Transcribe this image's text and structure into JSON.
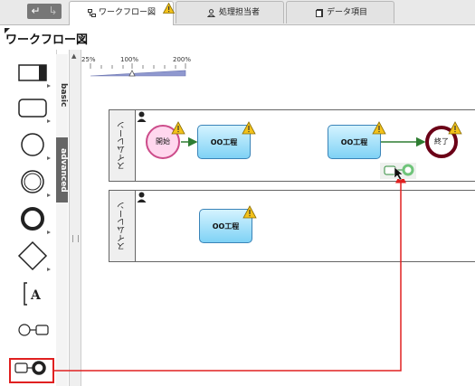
{
  "toolbar": {
    "undo_icon": "undo-arrow-icon",
    "redo_icon": "redo-arrow-icon"
  },
  "tabs": [
    {
      "label": "ワークフロー図",
      "icon": "flow-icon",
      "active": true,
      "warning": true
    },
    {
      "label": "処理担当者",
      "icon": "person-icon",
      "active": false
    },
    {
      "label": "データ項目",
      "icon": "document-icon",
      "active": false
    }
  ],
  "panel": {
    "title": "ワークフロー図"
  },
  "palette_tabs": [
    {
      "label": "basic"
    },
    {
      "label": "advanced"
    }
  ],
  "palette_items": [
    {
      "icon": "task-rectangle-icon"
    },
    {
      "icon": "rounded-rectangle-icon"
    },
    {
      "icon": "circle-icon"
    },
    {
      "icon": "double-circle-icon"
    },
    {
      "icon": "thick-circle-icon"
    },
    {
      "icon": "diamond-icon"
    },
    {
      "icon": "text-annotation-icon",
      "text": "A"
    },
    {
      "icon": "start-connector-icon"
    },
    {
      "icon": "end-connector-icon"
    }
  ],
  "zoom": {
    "min_label": "25%",
    "mid_label": "100%",
    "max_label": "200%",
    "current_percent": 100
  },
  "lanes": [
    {
      "label": "スイムレーン",
      "nodes": [
        {
          "type": "start",
          "label": "開始",
          "warning": true
        },
        {
          "type": "task",
          "label": "OO工程",
          "warning": true
        },
        {
          "type": "task",
          "label": "OO工程",
          "warning": true
        },
        {
          "type": "end",
          "label": "終了",
          "warning": true
        }
      ]
    },
    {
      "label": "スイムレーン",
      "nodes": [
        {
          "type": "task",
          "label": "OO工程",
          "warning": true
        }
      ]
    }
  ],
  "colors": {
    "highlight": "#e02020",
    "flow_arrow": "#2e7d32",
    "task_border": "#3a84b8",
    "start_border": "#cc4c8a",
    "end_border": "#6b0017"
  }
}
